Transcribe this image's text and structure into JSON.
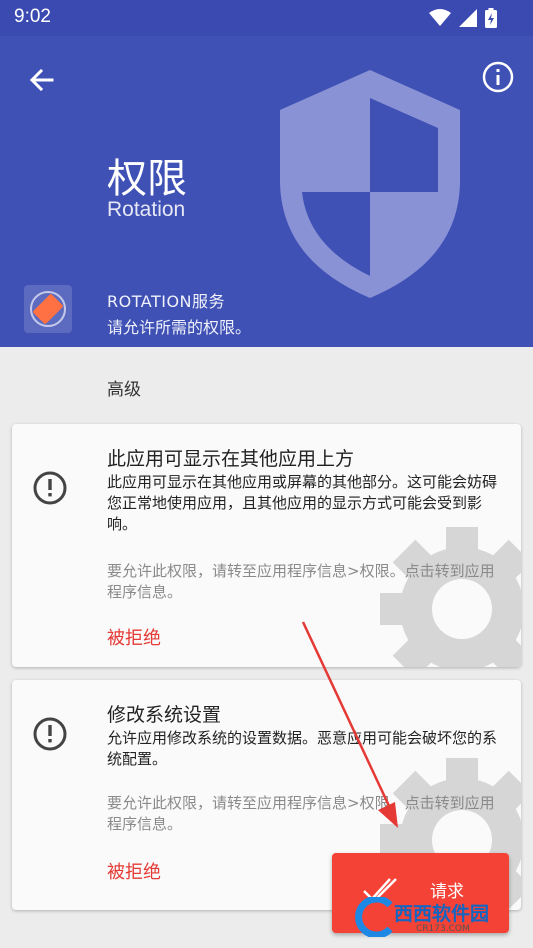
{
  "status_bar": {
    "time": "9:02"
  },
  "header": {
    "title": "权限",
    "subtitle": "Rotation",
    "service_name": "ROTATION服务",
    "service_desc": "请允许所需的权限。"
  },
  "section": {
    "label": "高级"
  },
  "permissions": [
    {
      "title": "此应用可显示在其他应用上方",
      "description": "此应用可显示在其他应用或屏幕的其他部分。这可能会妨碍您正常地使用应用，且其他应用的显示方式可能会受到影响。",
      "hint": "要允许此权限，请转至应用程序信息>权限。点击转到应用程序信息。",
      "status": "被拒绝"
    },
    {
      "title": "修改系统设置",
      "description": "允许应用修改系统的设置数据。恶意应用可能会破坏您的系统配置。",
      "hint": "要允许此权限，请转至应用程序信息>权限。点击转到应用程序信息。",
      "status": "被拒绝"
    }
  ],
  "request_button": {
    "label": "请求"
  },
  "watermark": {
    "brand": "西西软件园",
    "site": "CR173.COM"
  },
  "colors": {
    "header": "#3f51b5",
    "statusbar": "#3a4ab0",
    "accent_red": "#f44336",
    "denied_text": "#e53935",
    "background": "#ececec"
  },
  "icons": {
    "back": "arrow-back-icon",
    "info": "info-icon",
    "shield": "shield-icon",
    "app": "rotation-app-icon",
    "alert": "alert-circle-icon",
    "gear": "gear-icon",
    "request": "done-all-icon"
  }
}
